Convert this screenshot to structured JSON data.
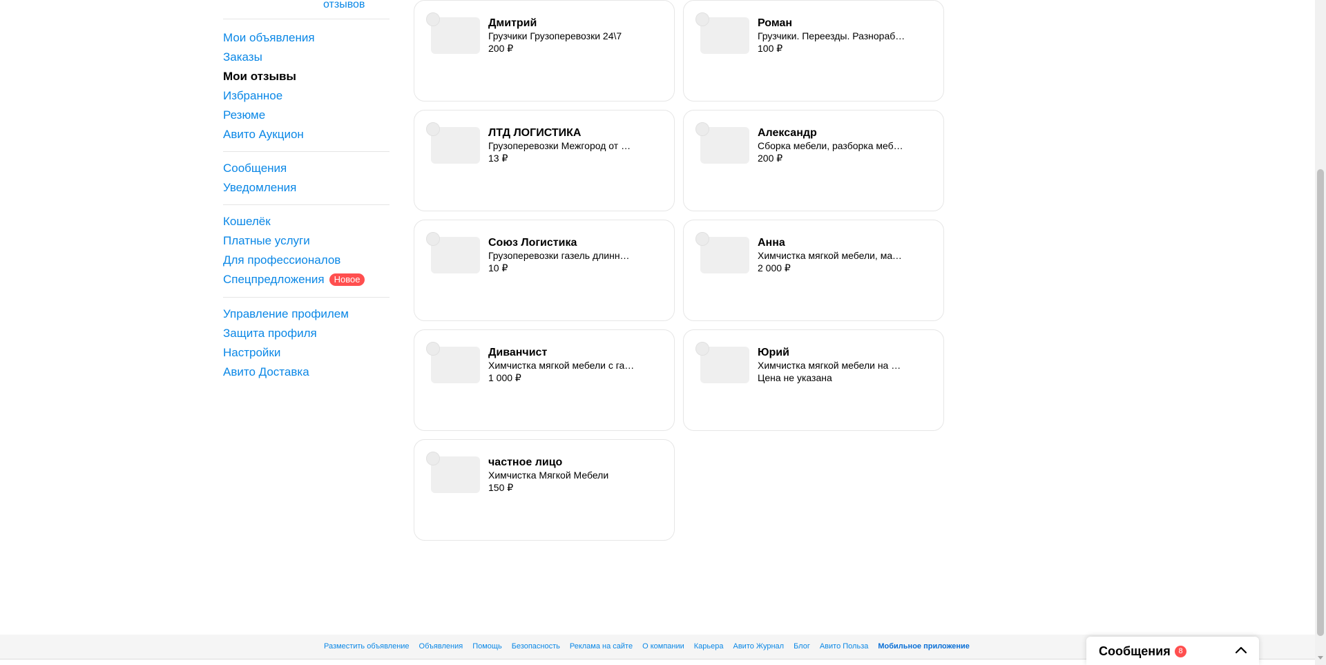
{
  "sidebar": {
    "reviews_link": "отзывов",
    "group1": [
      "Мои объявления",
      "Заказы",
      "Мои отзывы",
      "Избранное",
      "Резюме",
      "Авито Аукцион"
    ],
    "group2": [
      "Сообщения",
      "Уведомления"
    ],
    "group3": [
      "Кошелёк",
      "Платные услуги",
      "Для профессионалов",
      "Спецпредложения"
    ],
    "new_badge": "Новое",
    "group4": [
      "Управление профилем",
      "Защита профиля",
      "Настройки",
      "Авито Доставка"
    ]
  },
  "cards": [
    {
      "name": "Дмитрий",
      "desc": "Грузчики Грузоперевозки 24\\7",
      "price": "200 ₽"
    },
    {
      "name": "Роман",
      "desc": "Грузчики. Переезды. Разнораб…",
      "price": "100 ₽"
    },
    {
      "name": "ЛТД ЛОГИСТИКА",
      "desc": "Грузоперевозки Межгород от …",
      "price": "13 ₽"
    },
    {
      "name": "Александр",
      "desc": "Сборка мебели, разборка меб…",
      "price": "200 ₽"
    },
    {
      "name": "Союз Логистика",
      "desc": "Грузоперевозки газель длинн…",
      "price": "10 ₽"
    },
    {
      "name": "Анна",
      "desc": "Химчистка мягкой мебели, мат…",
      "price": "2 000 ₽"
    },
    {
      "name": "Диванчист",
      "desc": "Химчистка мягкой мебели с га…",
      "price": "1 000 ₽"
    },
    {
      "name": "Юрий",
      "desc": "Химчистка мягкой мебели на д…",
      "price": "Цена не указана"
    },
    {
      "name": "частное лицо",
      "desc": "Химчистка Мягкой Мебели",
      "price": "150 ₽"
    }
  ],
  "footer": {
    "links": [
      "Разместить объявление",
      "Объявления",
      "Помощь",
      "Безопасность",
      "Реклама на сайте",
      "О компании",
      "Карьера",
      "Авито Журнал",
      "Блог",
      "Авито Польза"
    ],
    "mobile_app": "Мобильное приложение"
  },
  "messenger": {
    "title": "Сообщения",
    "count": "8"
  }
}
